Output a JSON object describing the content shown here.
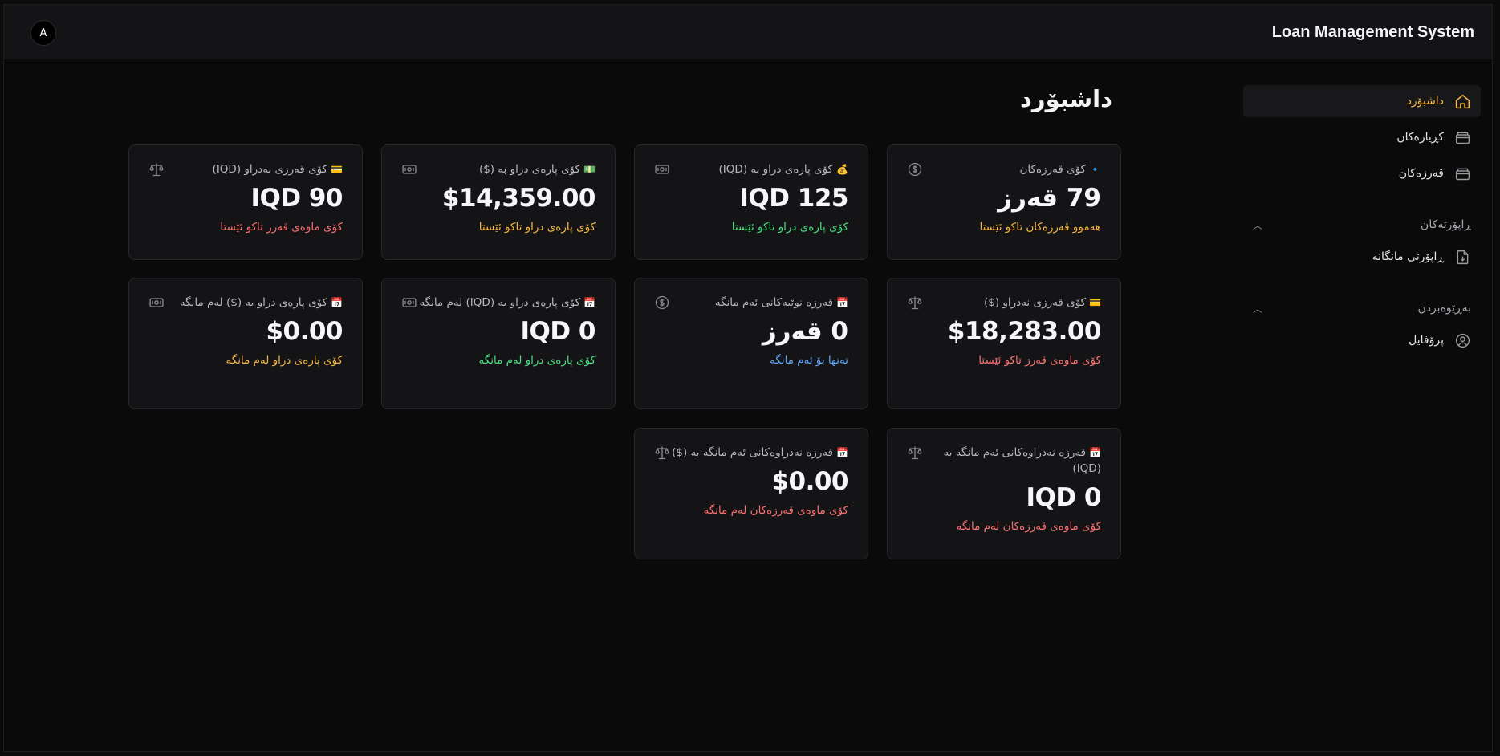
{
  "header": {
    "app_title": "Loan Management System",
    "avatar_initial": "A"
  },
  "sidebar": {
    "items": [
      {
        "label": "داشبۆرد",
        "icon": "home-icon",
        "active": true
      },
      {
        "label": "کڕیارەکان",
        "icon": "folder-icon"
      },
      {
        "label": "قەرزەکان",
        "icon": "folder-icon"
      }
    ],
    "sections": [
      {
        "title": "ڕاپۆرتەکان",
        "items": [
          {
            "label": "ڕاپۆرتی مانگانە",
            "icon": "file-download-icon"
          }
        ]
      },
      {
        "title": "بەڕێوەبردن",
        "items": [
          {
            "label": "پرۆفایل",
            "icon": "user-circle-icon"
          }
        ]
      }
    ]
  },
  "main": {
    "title": "داشبۆرد",
    "cards": [
      {
        "label": "کۆی قەرزەکان",
        "emoji": "🔹",
        "icon": "dollar-circle-icon",
        "value": "79 قەرز",
        "sub": "هەموو قەرزەکان تاکو ئێستا",
        "sub_color": "orange"
      },
      {
        "label": "کۆی پارەی دراو بە (IQD)",
        "emoji": "💰",
        "icon": "banknote-icon",
        "value": "IQD 125",
        "sub": "کۆی پارەی دراو تاکو ئێستا",
        "sub_color": "green"
      },
      {
        "label": "کۆی پارەی دراو بە ($)",
        "emoji": "💵",
        "icon": "banknote-icon",
        "value": "$14,359.00",
        "sub": "کۆی پارەی دراو تاکو ئێستا",
        "sub_color": "orange"
      },
      {
        "label": "کۆی قەرزی نەدراو (IQD)",
        "emoji": "💳",
        "icon": "scale-icon",
        "value": "IQD 90",
        "sub": "کۆی ماوەی قەرز تاکو ئێستا",
        "sub_color": "red"
      },
      {
        "label": "کۆی قەرزی نەدراو ($)",
        "emoji": "💳",
        "icon": "scale-icon",
        "value": "$18,283.00",
        "sub": "کۆی ماوەی قەرز تاکو ئێستا",
        "sub_color": "red"
      },
      {
        "label": "قەرزە نوێیەکانی ئەم مانگە",
        "emoji": "📅",
        "icon": "dollar-circle-icon",
        "value": "0 قەرز",
        "sub": "تەنها بۆ ئەم مانگە",
        "sub_color": "blue"
      },
      {
        "label": "کۆی پارەی دراو بە (IQD) لەم مانگە",
        "emoji": "📅",
        "icon": "banknote-icon",
        "value": "IQD 0",
        "sub": "کۆی پارەی دراو لەم مانگە",
        "sub_color": "green"
      },
      {
        "label": "کۆی پارەی دراو بە ($) لەم مانگە",
        "emoji": "📅",
        "icon": "banknote-icon",
        "value": "$0.00",
        "sub": "کۆی پارەی دراو لەم مانگە",
        "sub_color": "orange"
      },
      {
        "label": "قەرزە نەدراوەکانی ئەم مانگە بە (IQD)",
        "emoji": "📅",
        "icon": "scale-icon",
        "value": "IQD 0",
        "sub": "کۆی ماوەی قەرزەکان لەم مانگە",
        "sub_color": "red"
      },
      {
        "label": "قەرزە نەدراوەکانی ئەم مانگە بە ($)",
        "emoji": "📅",
        "icon": "scale-icon",
        "value": "$0.00",
        "sub": "کۆی ماوەی قەرزەکان لەم مانگە",
        "sub_color": "red"
      }
    ]
  }
}
